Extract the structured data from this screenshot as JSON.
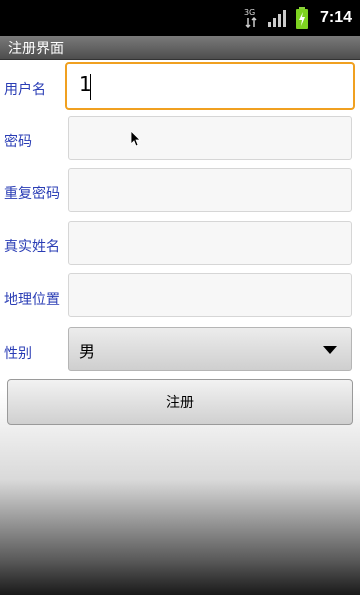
{
  "status_bar": {
    "network_label": "3G",
    "time": "7:14",
    "icons": [
      "network-3g-icon",
      "signal-icon",
      "battery-charging-icon"
    ]
  },
  "title_bar": {
    "title": "注册界面"
  },
  "form": {
    "username": {
      "label": "用户名",
      "value": "1"
    },
    "password": {
      "label": "密码",
      "value": ""
    },
    "confirm_password": {
      "label": "重复密码",
      "value": ""
    },
    "real_name": {
      "label": "真实姓名",
      "value": ""
    },
    "location": {
      "label": "地理位置",
      "value": ""
    },
    "gender": {
      "label": "性别",
      "selected": "男"
    }
  },
  "register_button": {
    "label": "注册"
  },
  "colors": {
    "label_text": "#2a3db5",
    "focus_border": "#f0a020",
    "title_bar": "#5e5e5e",
    "battery": "#7ed321"
  }
}
